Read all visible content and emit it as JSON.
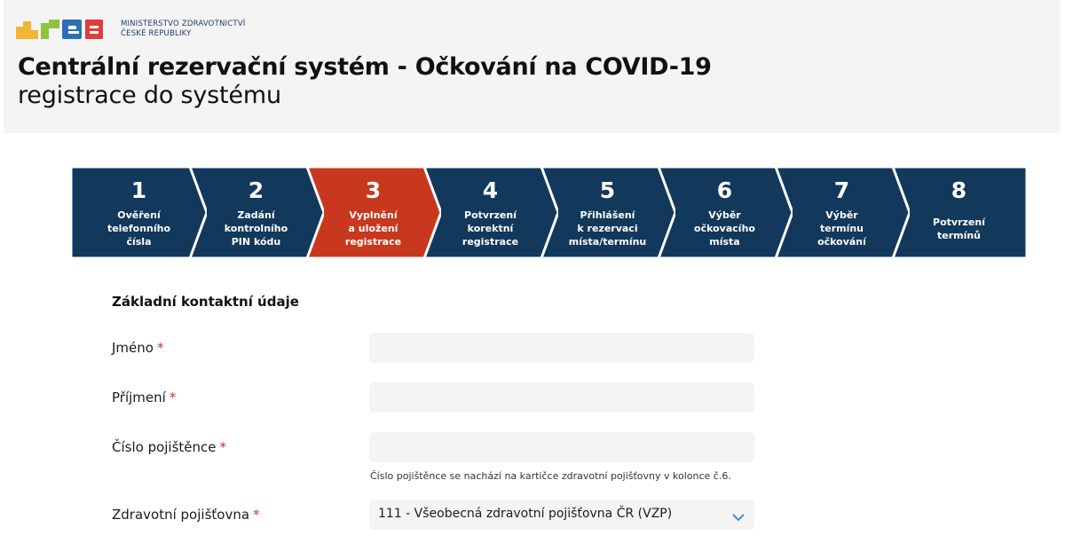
{
  "header": {
    "ministry_line1": "MINISTERSTVO ZDRAVOTNICTVÍ",
    "ministry_line2": "ČESKÉ REPUBLIKY",
    "title": "Centrální rezervační systém - Očkování na COVID-19",
    "subtitle": "registrace do systému"
  },
  "steps": [
    {
      "number": "1",
      "label": "Ověření\ntelefonního\nčísla",
      "active": false
    },
    {
      "number": "2",
      "label": "Zadání\nkontrolního\nPIN kódu",
      "active": false
    },
    {
      "number": "3",
      "label": "Vyplnění\na uložení\nregistrace",
      "active": true
    },
    {
      "number": "4",
      "label": "Potvrzení\nkorektní\nregistrace",
      "active": false
    },
    {
      "number": "5",
      "label": "Přihlášení\nk rezervaci\nmísta/termínu",
      "active": false
    },
    {
      "number": "6",
      "label": "Výběr\nočkovacího\nmísta",
      "active": false
    },
    {
      "number": "7",
      "label": "Výběr\ntermínu\nočkování",
      "active": false
    },
    {
      "number": "8",
      "label": "Potvrzení\ntermínů",
      "active": false
    }
  ],
  "colors": {
    "step_default": "#12385c",
    "step_active": "#c8381e",
    "required": "#d0312d",
    "chevron": "#3b8fd6"
  },
  "form": {
    "heading": "Základní kontaktní údaje",
    "first_name": {
      "label": "Jméno",
      "value": ""
    },
    "last_name": {
      "label": "Příjmení",
      "value": ""
    },
    "insurance_number": {
      "label": "Číslo pojištěnce",
      "value": "",
      "hint": "Číslo pojištěnce se nachází na kartičce zdravotní pojišťovny v kolonce č.6."
    },
    "insurer": {
      "label": "Zdravotní pojišťovna",
      "selected": "111 - Všeobecná zdravotní pojišťovna ČR (VZP)"
    },
    "required_mark": "*"
  }
}
